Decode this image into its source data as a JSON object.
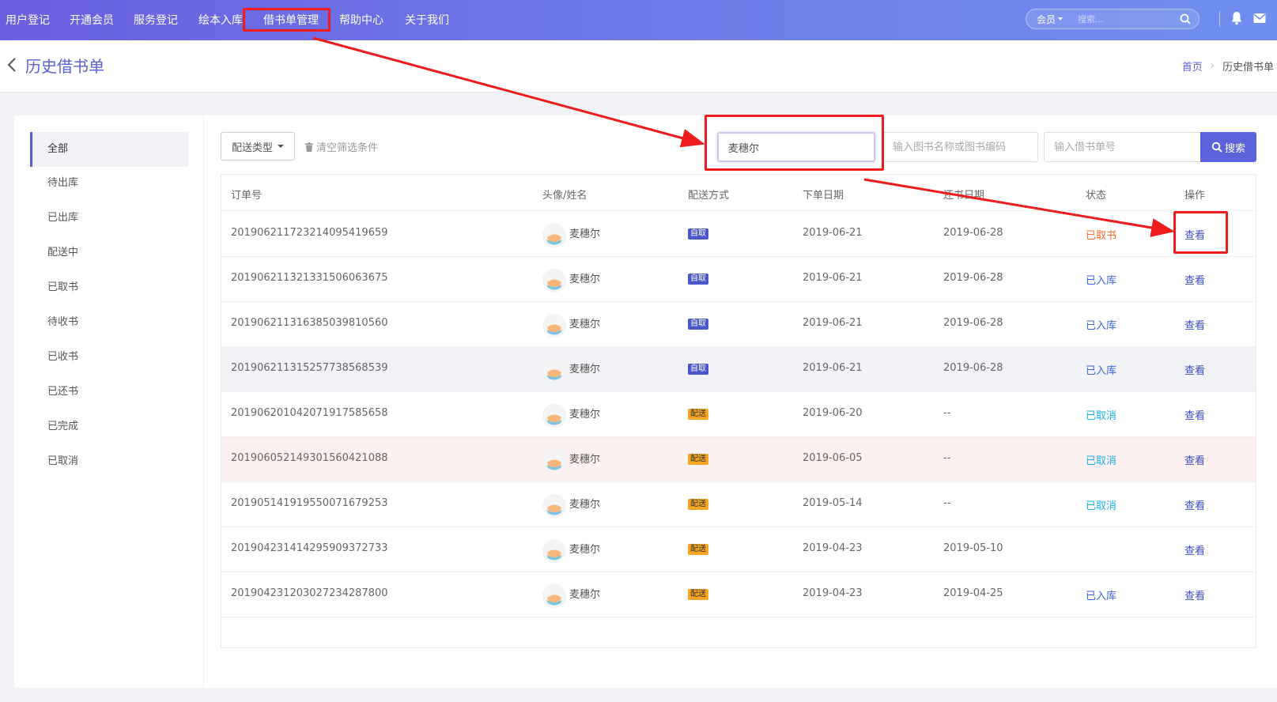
{
  "nav": {
    "items": [
      {
        "label": "用户登记"
      },
      {
        "label": "开通会员"
      },
      {
        "label": "服务登记"
      },
      {
        "label": "绘本入库"
      },
      {
        "label": "借书单管理"
      },
      {
        "label": "帮助中心"
      },
      {
        "label": "关于我们"
      }
    ],
    "member_label": "会员",
    "search_placeholder": "搜索..."
  },
  "header": {
    "title": "历史借书单",
    "breadcrumb_home": "首页",
    "breadcrumb_current": "历史借书单"
  },
  "sidebar": {
    "items": [
      {
        "label": "全部",
        "active": true
      },
      {
        "label": "待出库"
      },
      {
        "label": "已出库"
      },
      {
        "label": "配送中"
      },
      {
        "label": "已取书"
      },
      {
        "label": "待收书"
      },
      {
        "label": "已收书"
      },
      {
        "label": "已还书"
      },
      {
        "label": "已完成"
      },
      {
        "label": "已取消"
      }
    ]
  },
  "filters": {
    "delivery_type_label": "配送类型",
    "clear_label": "清空筛选条件",
    "name_value": "麦穗尔",
    "book_placeholder": "输入图书名称或图书编码",
    "order_placeholder": "输入借书单号",
    "search_label": "搜索"
  },
  "table": {
    "columns": [
      "订单号",
      "头像/姓名",
      "配送方式",
      "下单日期",
      "还书日期",
      "状态",
      "操作"
    ],
    "rows": [
      {
        "order": "20190621172321409541965 9",
        "name": "麦穗尔",
        "delivery": "自取",
        "order_date": "2019-06-21",
        "return_date": "2019-06-28",
        "status": "已取书",
        "action": "查看"
      },
      {
        "order": "20190621132133150606367 5",
        "name": "麦穗尔",
        "delivery": "自取",
        "order_date": "2019-06-21",
        "return_date": "2019-06-28",
        "status": "已入库",
        "action": "查看"
      },
      {
        "order": "20190621131638503981056 0",
        "name": "麦穗尔",
        "delivery": "自取",
        "order_date": "2019-06-21",
        "return_date": "2019-06-28",
        "status": "已入库",
        "action": "查看"
      },
      {
        "order": "20190621131525773856853 9",
        "name": "麦穗尔",
        "delivery": "自取",
        "order_date": "2019-06-21",
        "return_date": "2019-06-28",
        "status": "已入库",
        "action": "查看"
      },
      {
        "order": "20190620104207191758565 8",
        "name": "麦穗尔",
        "delivery": "配送",
        "order_date": "2019-06-20",
        "return_date": "--",
        "status": "已取消",
        "action": "查看"
      },
      {
        "order": "20190605214930156042108 8",
        "name": "麦穗尔",
        "delivery": "配送",
        "order_date": "2019-06-05",
        "return_date": "--",
        "status": "已取消",
        "action": "查看"
      },
      {
        "order": "20190514191955007167925 3",
        "name": "麦穗尔",
        "delivery": "配送",
        "order_date": "2019-05-14",
        "return_date": "--",
        "status": "已取消",
        "action": "查看"
      },
      {
        "order": "20190423141429590937273 3",
        "name": "麦穗尔",
        "delivery": "配送",
        "order_date": "2019-04-23",
        "return_date": "2019-05-10",
        "status": "",
        "action": "查看"
      },
      {
        "order": "20190423120302723428780 0",
        "name": "麦穗尔",
        "delivery": "配送",
        "order_date": "2019-04-23",
        "return_date": "2019-04-25",
        "status": "已入库",
        "action": "查看"
      }
    ]
  },
  "colors": {
    "accent": "#5b5fd6",
    "annotation": "#ee1c1c",
    "status_taken": "#fa6a2d",
    "status_stored": "#3b63db",
    "status_cancelled": "#1ab0e8"
  }
}
